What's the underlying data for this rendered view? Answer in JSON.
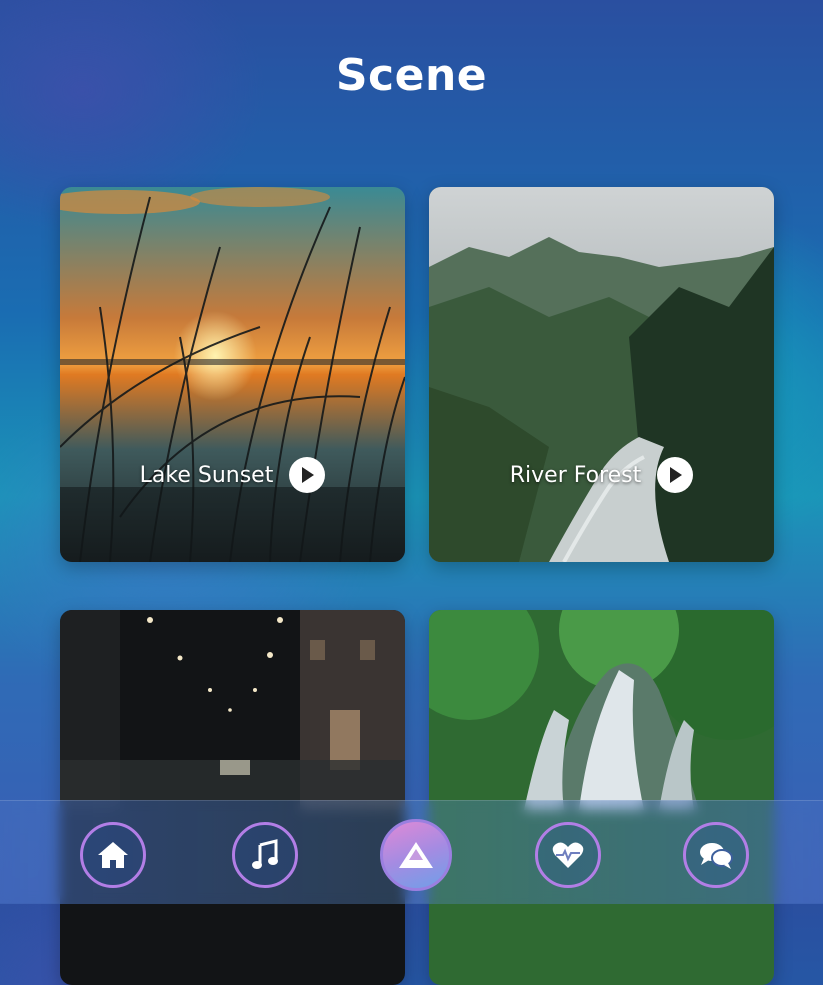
{
  "page": {
    "title": "Scene"
  },
  "scenes": [
    {
      "title": "Lake Sunset"
    },
    {
      "title": "River Forest"
    },
    {
      "title": "",
      "note": ""
    },
    {
      "title": ""
    }
  ],
  "navbar": {
    "items": [
      {
        "icon": "home-icon",
        "active": false
      },
      {
        "icon": "music-icon",
        "active": false
      },
      {
        "icon": "mountain-icon",
        "active": true
      },
      {
        "icon": "heart-pulse-icon",
        "active": false
      },
      {
        "icon": "chat-icon",
        "active": false
      }
    ]
  },
  "colors": {
    "accent_ring": "#b27ee6",
    "active_gradient_start": "#e08ad6",
    "active_gradient_end": "#6f9fe8",
    "text": "#ffffff"
  }
}
